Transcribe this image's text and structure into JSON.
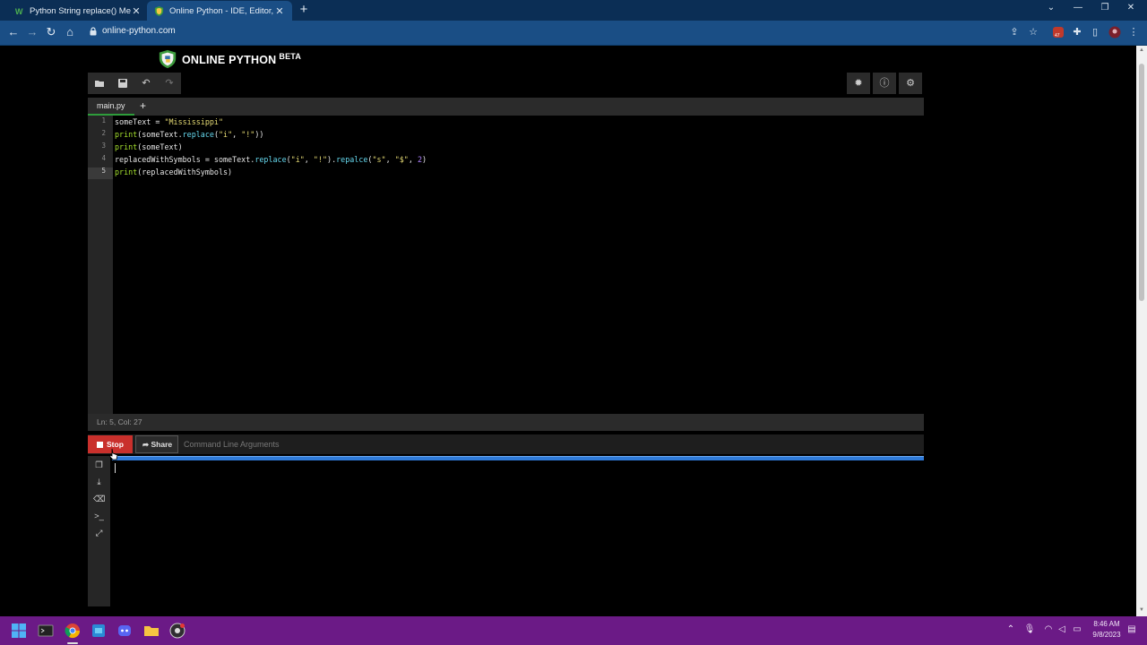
{
  "browser": {
    "tabs": [
      {
        "title": "Python String replace() Method",
        "active": false
      },
      {
        "title": "Online Python - IDE, Editor, Comp",
        "active": true
      }
    ],
    "url": "online-python.com",
    "extension_badge": "47"
  },
  "site": {
    "logo_text": "ONLINE PYTHON",
    "logo_badge": "BETA"
  },
  "editor": {
    "file_tab": "main.py",
    "add_tab_label": "+",
    "line_numbers": [
      "1",
      "2",
      "3",
      "4",
      "5"
    ],
    "code_lines": [
      "someText = \"Mississippi\"",
      "print(someText.replace(\"i\", \"!\"))",
      "print(someText)",
      "replacedWithSymbols = someText.replace(\"i\", \"!\").repalce(\"s\", \"$\", 2)",
      "print(replacedWithSymbols)"
    ],
    "status": "Ln: 5,  Col: 27"
  },
  "runbar": {
    "stop_label": "Stop",
    "share_label": "Share",
    "args_placeholder": "Command Line Arguments"
  },
  "taskbar": {
    "time": "8:46 AM",
    "date": "9/8/2023"
  },
  "colors": {
    "tab_strip": "#0b2e55",
    "toolbar": "#1a4e85",
    "stop_button": "#c9302c",
    "progress": "#2f7ad8",
    "taskbar": "#6b1a86"
  }
}
